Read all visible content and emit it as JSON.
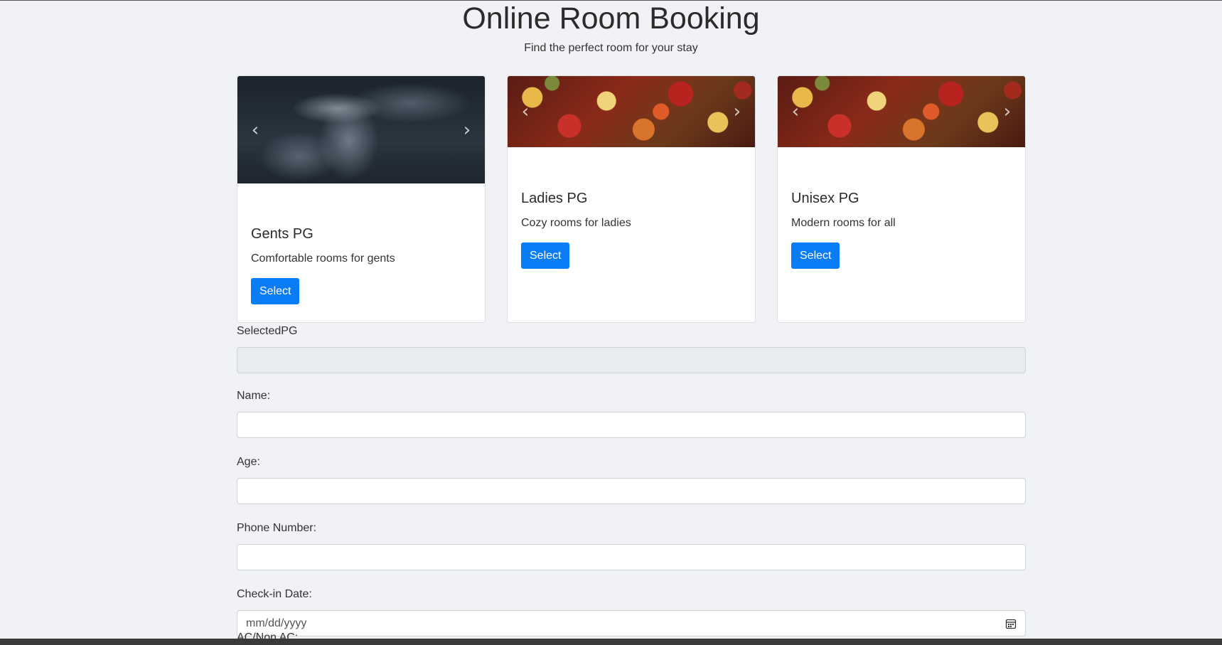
{
  "header": {
    "title": "Online Room Booking",
    "subtitle": "Find the perfect room for your stay"
  },
  "cards": [
    {
      "title": "Gents PG",
      "text": "Comfortable rooms for gents",
      "button": "Select"
    },
    {
      "title": "Ladies PG",
      "text": "Cozy rooms for ladies",
      "button": "Select"
    },
    {
      "title": "Unisex PG",
      "text": "Modern rooms for all",
      "button": "Select"
    }
  ],
  "form": {
    "selected_label": "SelectedPG",
    "selected_value": "",
    "name_label": "Name:",
    "age_label": "Age:",
    "phone_label": "Phone Number:",
    "checkin_label": "Check-in Date:",
    "checkin_placeholder": "mm/dd/yyyy",
    "ac_label": "AC/Non AC:"
  },
  "icons": {
    "prev": "chevron-left-icon",
    "next": "chevron-right-icon",
    "calendar": "calendar-icon"
  },
  "colors": {
    "primary_button": "#0a7cf5",
    "background": "#f0f2f5"
  }
}
